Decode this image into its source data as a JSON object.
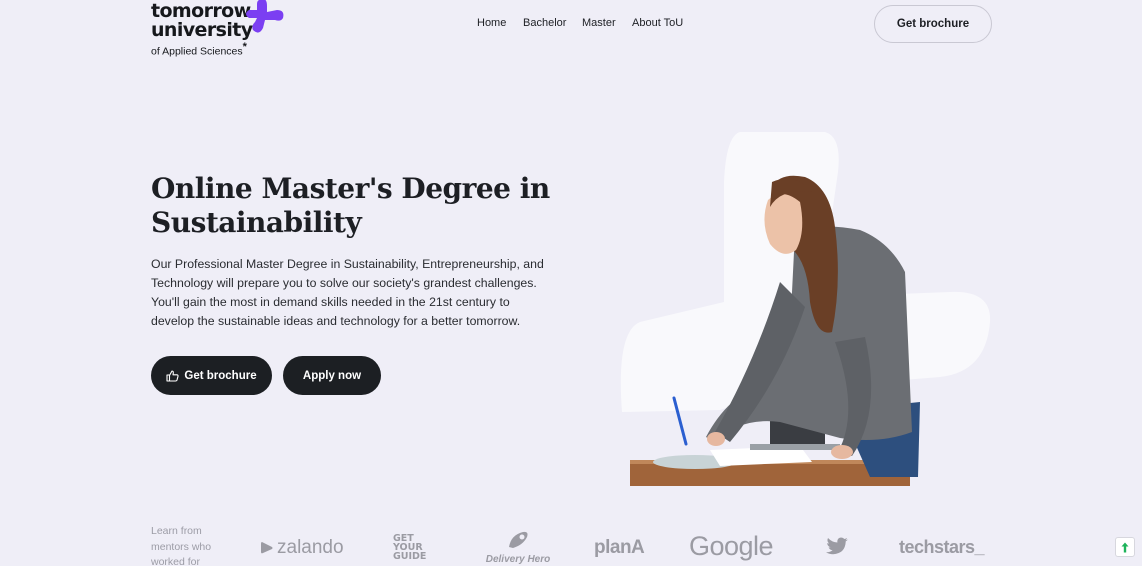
{
  "brand": {
    "line1": "tomorrow",
    "line2": "university",
    "line3": "of Applied Sciences",
    "star": "*",
    "accent": "#7b3ff2"
  },
  "nav": {
    "items": [
      "Home",
      "Bachelor",
      "Master",
      "About ToU"
    ]
  },
  "header": {
    "cta_label": "Get brochure"
  },
  "hero": {
    "title": "Online Master's Degree in Sustainability",
    "description": "Our Professional Master Degree in Sustainability, Entrepreneurship, and Technology will prepare you to solve our society's grandest challenges. You'll gain the most in demand skills needed in the 21st century to develop the sustainable ideas and technology for a better tomorrow.",
    "primary_button": "Get brochure",
    "secondary_button": "Apply now",
    "button_color": "#1c1f23",
    "page_bg": "#efeef7"
  },
  "partners": {
    "label": "Learn from mentors who worked for",
    "logos": {
      "zalando": "zalando",
      "gyg_1": "GET",
      "gyg_2": "YOUR",
      "gyg_3": "GUIDE",
      "delivery_hero": "Delivery Hero",
      "plana": "planA",
      "google": "Google",
      "twitter": "twitter-bird-icon",
      "techstars": "techstars_"
    }
  }
}
